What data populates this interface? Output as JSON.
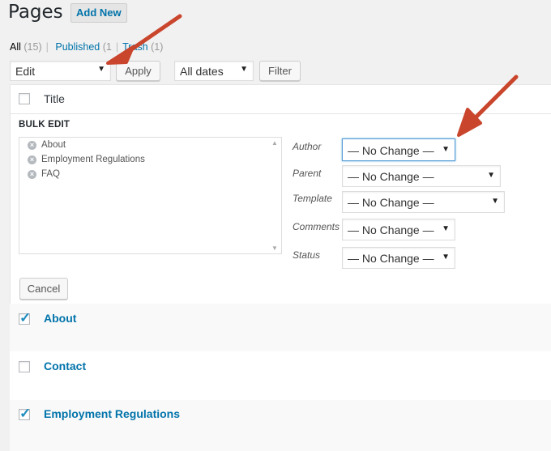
{
  "header": {
    "title": "Pages",
    "add_new": "Add New"
  },
  "filters": {
    "all": "All",
    "all_count": "(15)",
    "published": "Published",
    "published_count": "(1",
    "sep": "|",
    "trash": "Trash",
    "trash_count": "(1)"
  },
  "toolbar": {
    "bulk_action": "Edit",
    "apply": "Apply",
    "dates": "All dates",
    "filter": "Filter"
  },
  "table": {
    "title_header": "Title"
  },
  "bulk_edit": {
    "heading": "BULK EDIT",
    "items": [
      "About",
      "Employment Regulations",
      "FAQ"
    ],
    "fields": [
      {
        "label": "Author",
        "value": "— No Change —"
      },
      {
        "label": "Parent",
        "value": "— No Change —"
      },
      {
        "label": "Template",
        "value": "— No Change —"
      },
      {
        "label": "Comments",
        "value": "— No Change —"
      },
      {
        "label": "Status",
        "value": "— No Change —"
      }
    ],
    "cancel": "Cancel"
  },
  "rows": [
    {
      "title": "About",
      "checked": true
    },
    {
      "title": "Contact",
      "checked": false
    },
    {
      "title": "Employment Regulations",
      "checked": true
    }
  ],
  "colors": {
    "accent": "#0073aa",
    "annotation_arrow": "#c9452c"
  }
}
